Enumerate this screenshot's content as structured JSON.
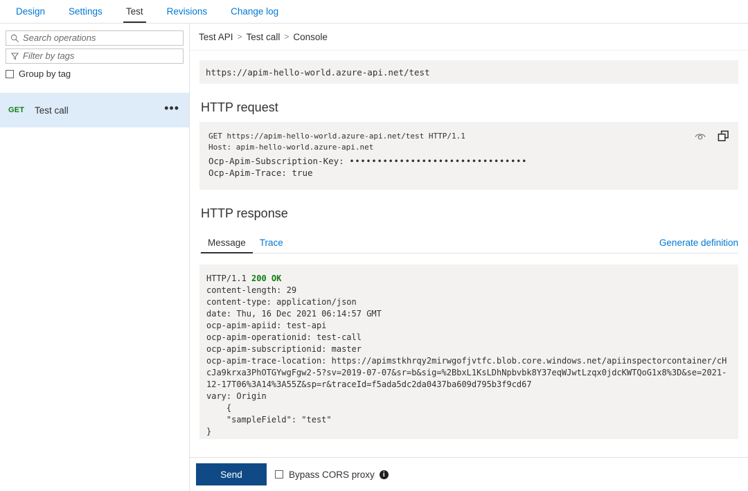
{
  "top_tabs": [
    {
      "label": "Design",
      "active": false
    },
    {
      "label": "Settings",
      "active": false
    },
    {
      "label": "Test",
      "active": true
    },
    {
      "label": "Revisions",
      "active": false
    },
    {
      "label": "Change log",
      "active": false
    }
  ],
  "sidebar": {
    "search": {
      "placeholder": "Search operations",
      "value": "",
      "icon": "search-icon"
    },
    "filter": {
      "placeholder": "Filter by tags",
      "value": "",
      "icon": "filter-icon"
    },
    "group_by_tag": {
      "label": "Group by tag",
      "checked": false
    },
    "operations": [
      {
        "method": "GET",
        "name": "Test call",
        "selected": true,
        "more": "•••"
      }
    ]
  },
  "breadcrumb": {
    "items": [
      "Test API",
      "Test call",
      "Console"
    ],
    "separator": ">"
  },
  "console": {
    "url": "https://apim-hello-world.azure-api.net/test",
    "request": {
      "heading": "HTTP request",
      "line1": "GET https://apim-hello-world.azure-api.net/test HTTP/1.1",
      "line2": "Host: apim-hello-world.azure-api.net",
      "line3_label": "Ocp-Apim-Subscription-Key: ",
      "line3_value": "••••••••••••••••••••••••••••••••",
      "line4": "Ocp-Apim-Trace: true",
      "reveal_icon": "eye-icon",
      "copy_icon": "copy-icon"
    },
    "response": {
      "heading": "HTTP response",
      "tabs": [
        {
          "label": "Message",
          "active": true
        },
        {
          "label": "Trace",
          "active": false
        }
      ],
      "generate_definition": "Generate definition",
      "status_line_prefix": "HTTP/1.1 ",
      "status_code": "200 OK",
      "body": "\ncontent-length: 29\ncontent-type: application/json\ndate: Thu, 16 Dec 2021 06:14:57 GMT\nocp-apim-apiid: test-api\nocp-apim-operationid: test-call\nocp-apim-subscriptionid: master\nocp-apim-trace-location: https://apimstkhrqy2mirwgofjvtfc.blob.core.windows.net/apiinspectorcontainer/cHcJa9krxa3PhOTGYwgFgw2-5?sv=2019-07-07&sr=b&sig=%2BbxL1KsLDhNpbvbk8Y37eqWJwtLzqx0jdcKWTQoG1x8%3D&se=2021-12-17T06%3A14%3A55Z&sp=r&traceId=f5ada5dc2da0437ba609d795b3f9cd67\nvary: Origin\n    {\n    \"sampleField\": \"test\"\n}"
    }
  },
  "footer": {
    "send_label": "Send",
    "bypass_cors": {
      "label": "Bypass CORS proxy",
      "checked": false,
      "info_icon": "info-icon",
      "info_glyph": "i"
    }
  },
  "colors": {
    "accent_link": "#0078d4",
    "method_get": "#107c10",
    "status_ok": "#107c10",
    "send_button": "#0f4a86",
    "selected_row": "#deecf9",
    "code_background": "#f3f2f1"
  }
}
